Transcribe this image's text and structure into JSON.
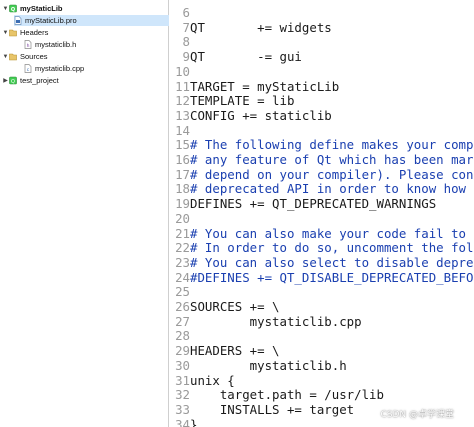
{
  "project_tree": {
    "project_name": "myStaticLib",
    "pro_file": "myStaticLib.pro",
    "headers_label": "Headers",
    "header_file": "mystaticlib.h",
    "sources_label": "Sources",
    "source_file": "mystaticlib.cpp",
    "other_project": "test_project"
  },
  "editor": {
    "lines": [
      {
        "n": "6",
        "t": "",
        "c": false
      },
      {
        "n": "7",
        "t": "QT       += widgets",
        "c": false
      },
      {
        "n": "8",
        "t": "",
        "c": false
      },
      {
        "n": "9",
        "t": "QT       -= gui",
        "c": false
      },
      {
        "n": "10",
        "t": "",
        "c": false
      },
      {
        "n": "11",
        "t": "TARGET = myStaticLib",
        "c": false
      },
      {
        "n": "12",
        "t": "TEMPLATE = lib",
        "c": false
      },
      {
        "n": "13",
        "t": "CONFIG += staticlib",
        "c": false
      },
      {
        "n": "14",
        "t": "",
        "c": false
      },
      {
        "n": "15",
        "t": "# The following define makes your compil",
        "c": true
      },
      {
        "n": "16",
        "t": "# any feature of Qt which has been marke",
        "c": true
      },
      {
        "n": "17",
        "t": "# depend on your compiler). Please consu",
        "c": true
      },
      {
        "n": "18",
        "t": "# deprecated API in order to know how to",
        "c": true
      },
      {
        "n": "19",
        "t": "DEFINES += QT_DEPRECATED_WARNINGS",
        "c": false
      },
      {
        "n": "20",
        "t": "",
        "c": false
      },
      {
        "n": "21",
        "t": "# You can also make your code fail to co",
        "c": true
      },
      {
        "n": "22",
        "t": "# In order to do so, uncomment the follo",
        "c": true
      },
      {
        "n": "23",
        "t": "# You can also select to disable depreca",
        "c": true
      },
      {
        "n": "24",
        "t": "#DEFINES += QT_DISABLE_DEPRECATED_BEFORE",
        "c": true
      },
      {
        "n": "25",
        "t": "",
        "c": false
      },
      {
        "n": "26",
        "t": "SOURCES += \\",
        "c": false
      },
      {
        "n": "27",
        "t": "        mystaticlib.cpp",
        "c": false
      },
      {
        "n": "28",
        "t": "",
        "c": false
      },
      {
        "n": "29",
        "t": "HEADERS += \\",
        "c": false
      },
      {
        "n": "30",
        "t": "        mystaticlib.h",
        "c": false
      },
      {
        "n": "31",
        "t": "unix {",
        "c": false
      },
      {
        "n": "32",
        "t": "    target.path = /usr/lib",
        "c": false
      },
      {
        "n": "33",
        "t": "    INSTALLS += target",
        "c": false
      },
      {
        "n": "34",
        "t": "}",
        "c": false
      }
    ]
  },
  "watermark": "CSDN @卓学课堂",
  "colors": {
    "comment": "#1a3fb0",
    "selection": "#cfe6fb",
    "line_number": "#9a9a9a"
  }
}
